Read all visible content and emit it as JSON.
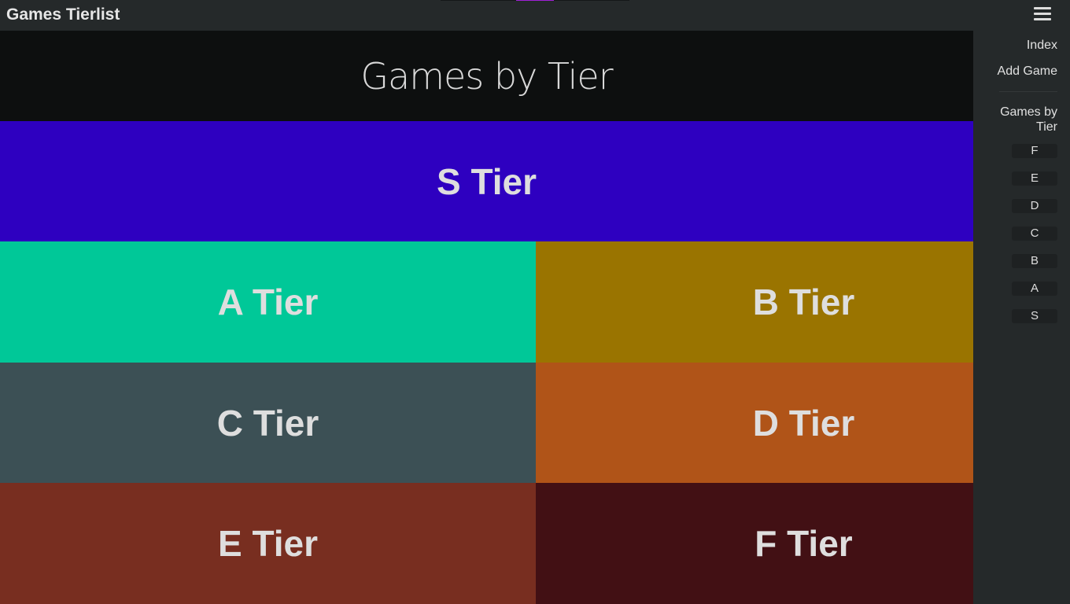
{
  "app": {
    "title": "Games Tierlist",
    "menu_icon": "hamburger-icon",
    "progress_accent": "#a020d8"
  },
  "header": {
    "title": "Games by Tier"
  },
  "tiers": [
    {
      "label": "S Tier",
      "color": "#2e00c0"
    },
    {
      "label": "A Tier",
      "color": "#00c898"
    },
    {
      "label": "B Tier",
      "color": "#9a7400"
    },
    {
      "label": "C Tier",
      "color": "#3c5055"
    },
    {
      "label": "D Tier",
      "color": "#b05418"
    },
    {
      "label": "E Tier",
      "color": "#782e20"
    },
    {
      "label": "F Tier",
      "color": "#421014"
    }
  ],
  "sidebar": {
    "links": [
      "Index",
      "Add Game"
    ],
    "section": "Games by Tier",
    "tier_links": [
      "F",
      "E",
      "D",
      "C",
      "B",
      "A",
      "S"
    ]
  }
}
